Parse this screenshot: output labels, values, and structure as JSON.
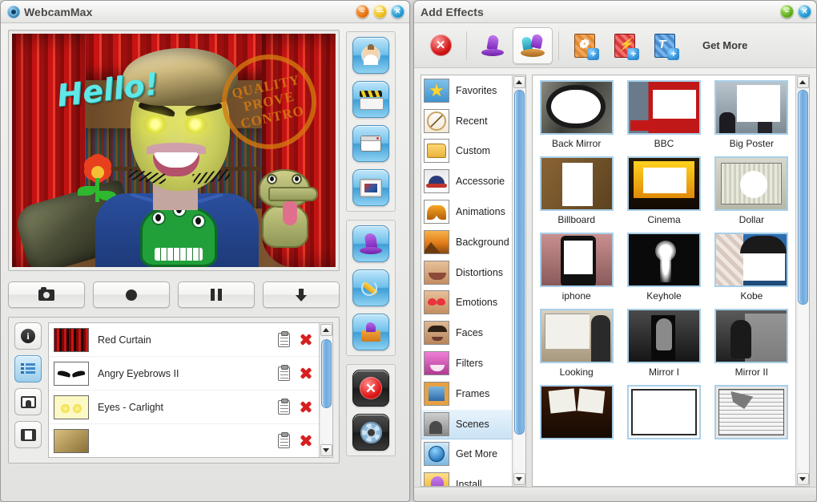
{
  "main_window": {
    "title": "WebcamMax",
    "title_icon": "webcam-logo-icon",
    "window_buttons": [
      {
        "name": "minimize-button",
        "glyph": "–"
      },
      {
        "name": "maximize-button",
        "glyph": "—"
      },
      {
        "name": "close-button",
        "glyph": "✕"
      }
    ],
    "preview": {
      "overlay_text": "Hello!",
      "stamp_line1": "QUALITY",
      "stamp_line2": "PROVE",
      "stamp_line3": "CONTRO"
    },
    "transport_buttons": [
      {
        "name": "snapshot-button",
        "icon": "camera-icon"
      },
      {
        "name": "record-button",
        "icon": "record-circle-icon"
      },
      {
        "name": "pause-button",
        "icon": "pause-icon"
      },
      {
        "name": "save-button",
        "icon": "download-arrow-icon"
      }
    ],
    "list_side_buttons": [
      {
        "name": "info-button",
        "icon": "info-icon",
        "active": false
      },
      {
        "name": "effects-list-button",
        "icon": "list-icon",
        "active": true
      },
      {
        "name": "picture-button",
        "icon": "picture-icon",
        "active": false
      },
      {
        "name": "film-button",
        "icon": "film-icon",
        "active": false
      }
    ],
    "applied_effects": [
      {
        "name": "Red Curtain",
        "thumb": "red-curtain-thumb"
      },
      {
        "name": "Angry Eyebrows II",
        "thumb": "angry-eyebrows-thumb"
      },
      {
        "name": "Eyes - Carlight",
        "thumb": "eyes-carlight-thumb"
      },
      {
        "name": "",
        "thumb": "hair-thumb"
      }
    ],
    "row_actions": [
      {
        "name": "settings-clipboard-icon"
      },
      {
        "name": "remove-effect-icon"
      }
    ],
    "rail_groups": [
      {
        "name": "source-group",
        "buttons": [
          {
            "name": "webcam-source-button",
            "icon": "person-icon"
          },
          {
            "name": "video-source-button",
            "icon": "clapboard-icon"
          },
          {
            "name": "desktop-source-button",
            "icon": "window-icon"
          },
          {
            "name": "picture-source-button",
            "icon": "framed-picture-icon"
          }
        ]
      },
      {
        "name": "effects-group",
        "buttons": [
          {
            "name": "effects-button",
            "icon": "magic-hat-icon"
          },
          {
            "name": "doodle-button",
            "icon": "pencil-icon"
          },
          {
            "name": "effects-package-button",
            "icon": "open-box-icon"
          }
        ]
      },
      {
        "name": "system-group",
        "buttons": [
          {
            "name": "exit-button",
            "icon": "red-stop-icon"
          },
          {
            "name": "settings-button",
            "icon": "gear-icon"
          }
        ]
      }
    ]
  },
  "effects_window": {
    "title": "Add Effects",
    "window_buttons": [
      {
        "name": "minimize-button",
        "glyph": "–"
      },
      {
        "name": "close-button",
        "glyph": "✕"
      }
    ],
    "toolbar": {
      "get_more_label": "Get More",
      "items": [
        {
          "name": "remove-all-effects-button",
          "icon": "red-close-icon",
          "selected": false
        },
        {
          "name": "single-effect-tab",
          "icon": "purple-hat-icon",
          "selected": false
        },
        {
          "name": "multi-effect-tab",
          "icon": "multi-hat-icon",
          "selected": true
        },
        {
          "name": "add-image-button",
          "icon": "add-image-doc-icon",
          "selected": false
        },
        {
          "name": "add-flash-button",
          "icon": "add-flash-doc-icon",
          "selected": false
        },
        {
          "name": "add-text-button",
          "icon": "add-text-doc-icon",
          "selected": false
        }
      ]
    },
    "categories": [
      {
        "label": "Favorites",
        "icon": "favorites-star-icon",
        "selected": false
      },
      {
        "label": "Recent",
        "icon": "recent-clock-icon",
        "selected": false
      },
      {
        "label": "Custom",
        "icon": "custom-folder-icon",
        "selected": false
      },
      {
        "label": "Accessorie",
        "icon": "accessories-cap-icon",
        "selected": false
      },
      {
        "label": "Animations",
        "icon": "animations-butterfly-icon",
        "selected": false
      },
      {
        "label": "Background",
        "icon": "background-scene-icon",
        "selected": false
      },
      {
        "label": "Distortions",
        "icon": "distortions-face-icon",
        "selected": false
      },
      {
        "label": "Emotions",
        "icon": "emotions-face-icon",
        "selected": false
      },
      {
        "label": "Faces",
        "icon": "faces-icon",
        "selected": false
      },
      {
        "label": "Filters",
        "icon": "filters-face-icon",
        "selected": false
      },
      {
        "label": "Frames",
        "icon": "frames-icon",
        "selected": false
      },
      {
        "label": "Scenes",
        "icon": "scenes-icon",
        "selected": true
      },
      {
        "label": "Get More",
        "icon": "get-more-globe-icon",
        "selected": false
      },
      {
        "label": "Install",
        "icon": "install-icon",
        "selected": false
      }
    ],
    "effects": [
      {
        "label": "Back Mirror",
        "art": "t-backmirror"
      },
      {
        "label": "BBC",
        "art": "t-bbc"
      },
      {
        "label": "Big Poster",
        "art": "t-bigposter"
      },
      {
        "label": "Billboard",
        "art": "t-billboard"
      },
      {
        "label": "Cinema",
        "art": "t-cinema"
      },
      {
        "label": "Dollar",
        "art": "t-dollar"
      },
      {
        "label": "iphone",
        "art": "t-iphone"
      },
      {
        "label": "Keyhole",
        "art": "t-keyhole"
      },
      {
        "label": "Kobe",
        "art": "t-kobe"
      },
      {
        "label": "Looking",
        "art": "t-looking"
      },
      {
        "label": "Mirror I",
        "art": "t-mirror1"
      },
      {
        "label": "Mirror II",
        "art": "t-mirror2"
      },
      {
        "label": "",
        "art": "t-movie"
      },
      {
        "label": "",
        "art": "t-blank"
      },
      {
        "label": "",
        "art": "t-news"
      }
    ]
  },
  "colors": {
    "accent_blue": "#6fa9de",
    "selection_blue": "#c9e2f4",
    "thumb_border": "#a8cfe8",
    "delete_red": "#d81f1f",
    "window_chrome": "#eeeeec"
  }
}
